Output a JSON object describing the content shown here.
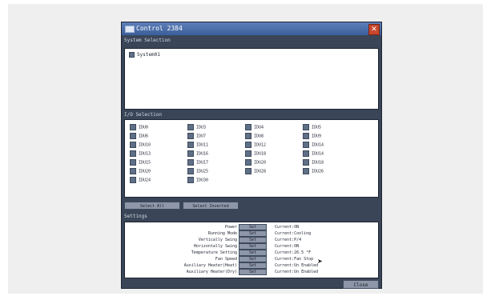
{
  "window": {
    "title": "Control 2384"
  },
  "system_section": {
    "label": "System Selection",
    "items": [
      {
        "label": "System01"
      }
    ]
  },
  "io_section": {
    "label": "I/O Selection",
    "items": [
      "IDU0",
      "IDU3",
      "IDU4",
      "IDU5",
      "IDU6",
      "IDU7",
      "IDU8",
      "IDU9",
      "IDU10",
      "IDU11",
      "IDU12",
      "IDU14",
      "IDU13",
      "IDU16",
      "IDU18",
      "IDU14",
      "IDU15",
      "IDU17",
      "IDU20",
      "IDU18",
      "IDU20",
      "IDU25",
      "IDU28",
      "IDU26",
      "IDU24",
      "IDU30"
    ]
  },
  "buttons": {
    "select_all": "Select All",
    "select_inverted": "Select Inverted",
    "set": "Set",
    "close": "Close"
  },
  "settings_section": {
    "label": "Settings",
    "rows": [
      {
        "label": "Power",
        "current": "Current:ON"
      },
      {
        "label": "Running Mode",
        "current": "Current:Cooling"
      },
      {
        "label": "Vertically Swing",
        "current": "Current:P/4"
      },
      {
        "label": "Horizontally Swing",
        "current": "Current:ON"
      },
      {
        "label": "Temperature Setting",
        "current": "Current:26.5 °F"
      },
      {
        "label": "Fan Speed",
        "current": "Current:Fan Stop"
      },
      {
        "label": "Auxiliary Heater(Heat)",
        "current": "Current:Un Enabled"
      },
      {
        "label": "Auxiliary Heater(Dry)",
        "current": "Current:Un Enabled"
      }
    ]
  },
  "colors": {
    "dialog_bg": "#3a4657",
    "titlebar": "#4b6dab",
    "close_red": "#c8482c",
    "button": "#8d97a8"
  }
}
